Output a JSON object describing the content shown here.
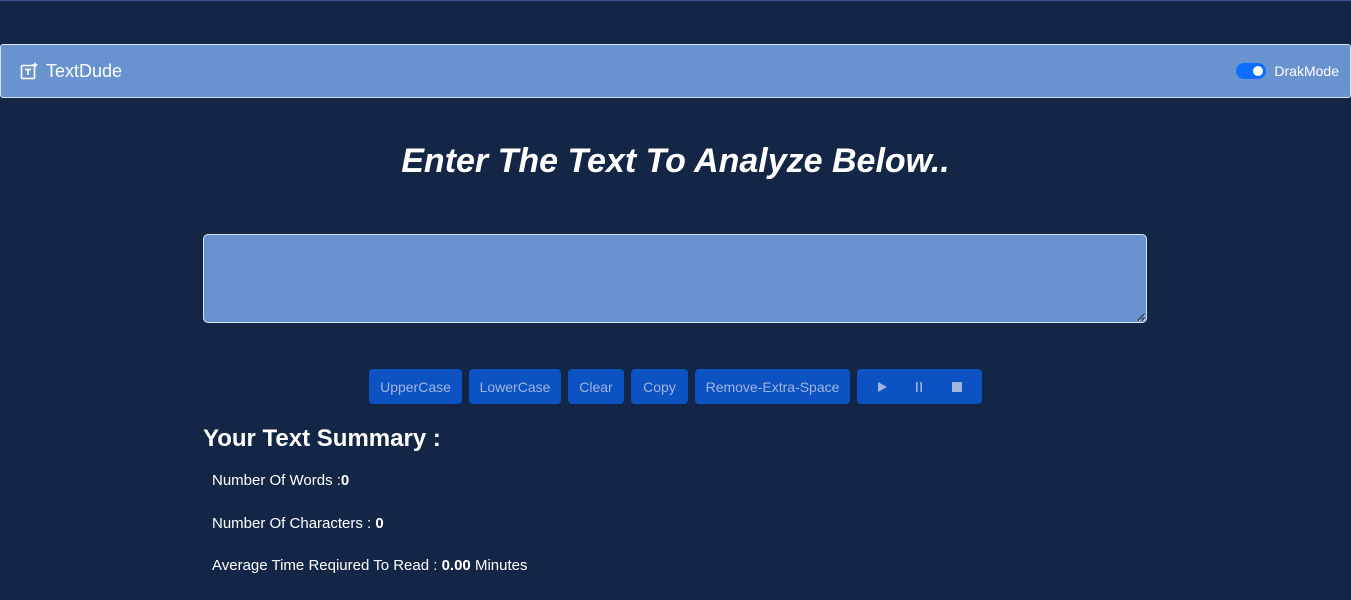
{
  "navbar": {
    "brand": "TextDude",
    "brand_icon": "text-add-icon",
    "mode_label": "DrakMode",
    "mode_enabled": true
  },
  "main": {
    "heading": "Enter The Text To Analyze Below..",
    "textarea_value": "",
    "buttons": {
      "uppercase": "UpperCase",
      "lowercase": "LowerCase",
      "clear": "Clear",
      "copy": "Copy",
      "remove_space": "Remove-Extra-Space"
    },
    "media_icons": [
      "play-icon",
      "pause-icon",
      "stop-icon"
    ]
  },
  "summary": {
    "title": "Your Text Summary :",
    "words_label": "Number Of Words :",
    "words_value": "0",
    "chars_label": "Number Of Characters : ",
    "chars_value": "0",
    "time_label": "Average Time Reqiured To Read : ",
    "time_value": "0.00",
    "time_unit": " Minutes"
  },
  "colors": {
    "background": "#132646",
    "navbar": "#6893cf",
    "button": "#0d52c2",
    "toggle": "#0d6efd"
  }
}
